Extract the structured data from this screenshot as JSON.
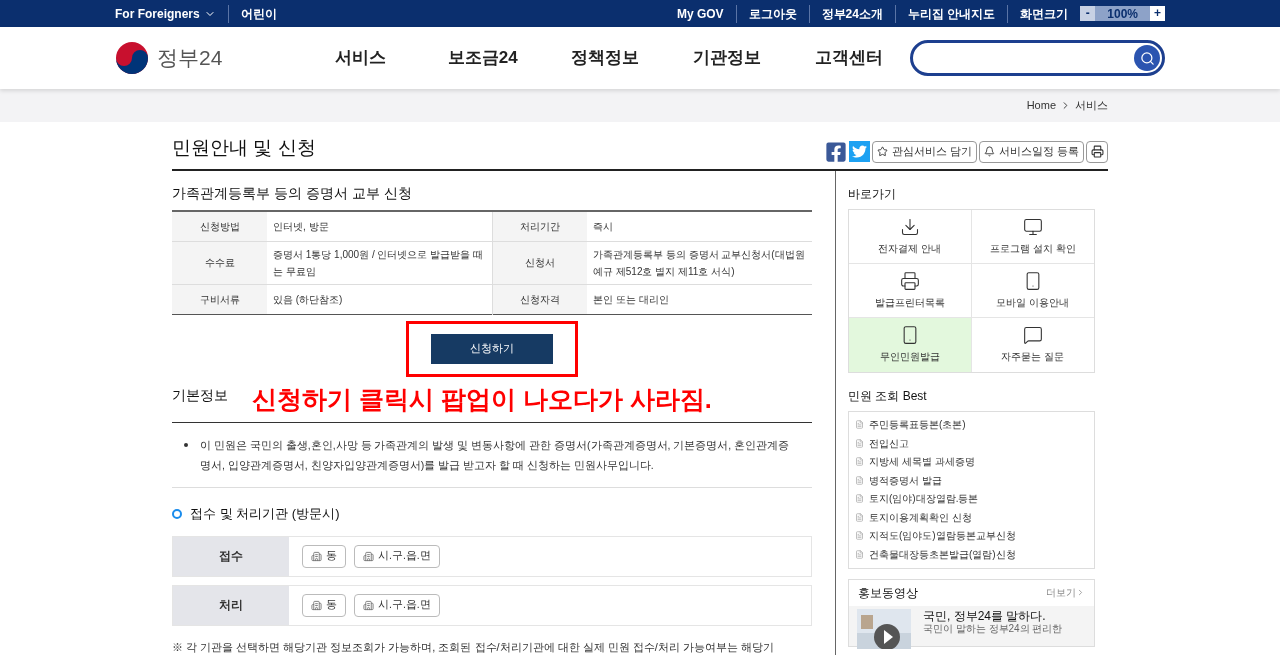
{
  "topbar": {
    "left": [
      {
        "label": "For Foreigners",
        "dropdown": true
      },
      {
        "label": "어린이",
        "dropdown": false
      }
    ],
    "right": [
      "My GOV",
      "로그아웃",
      "정부24소개",
      "누리집 안내지도"
    ],
    "zoom": {
      "label": "화면크기",
      "minus": "-",
      "value": "100%",
      "plus": "+"
    }
  },
  "header": {
    "logo": "정부24",
    "nav": [
      "서비스",
      "보조금24",
      "정책정보",
      "기관정보",
      "고객센터"
    ]
  },
  "breadcrumb": [
    "Home",
    "서비스"
  ],
  "page_title": "민원안내 및 신청",
  "actions": [
    {
      "kind": "star",
      "label": "관심서비스 담기"
    },
    {
      "kind": "bell",
      "label": "서비스일정 등록"
    }
  ],
  "service": {
    "title": "가족관계등록부 등의 증명서 교부 신청",
    "rows": [
      [
        {
          "label": "신청방법",
          "value": "인터넷, 방문"
        },
        {
          "label": "처리기간",
          "value": "즉시"
        }
      ],
      [
        {
          "label": "수수료",
          "value": "증명서 1통당 1,000원 / 인터넷으로 발급받을 때는 무료임"
        },
        {
          "label": "신청서",
          "value": "가족관계등록부 등의 증명서 교부신청서(대법원 예규 제512호 별지 제11호 서식)"
        }
      ],
      [
        {
          "label": "구비서류",
          "value": "있음 (하단참조)"
        },
        {
          "label": "신청자격",
          "value": "본인 또는 대리인"
        }
      ]
    ],
    "apply_button": "신청하기"
  },
  "annotation": "신청하기 클릭시 팝업이 나오다가 사라짐.",
  "basic_info": {
    "heading": "기본정보",
    "text": "이 민원은 국민의 출생,혼인,사망 등 가족관계의 발생 및 변동사항에 관한 증명서(가족관계증명서, 기본증명서, 혼인관계증명서, 입양관계증명서, 친양자입양관계증명서)를 발급 받고자 할 때 신청하는 민원사무입니다."
  },
  "agencies": {
    "heading": "접수 및 처리기관 (방문시)",
    "rows": [
      {
        "label": "접수",
        "items": [
          "동",
          "시.구.읍.면"
        ]
      },
      {
        "label": "처리",
        "items": [
          "동",
          "시.구.읍.면"
        ]
      }
    ]
  },
  "note": "※ 각 기관을 선택하면 해당기관 정보조회가 가능하며, 조회된 접수/처리기관에 대한 실제 민원 접수/처리 가능여부는 해당기",
  "quick": {
    "title": "바로가기",
    "items": [
      {
        "kind": "download",
        "label": "전자결제 안내",
        "highlighted": false
      },
      {
        "kind": "monitor",
        "label": "프로그램 설치 확인",
        "highlighted": false
      },
      {
        "kind": "printer",
        "label": "발급프린터목록",
        "highlighted": false
      },
      {
        "kind": "phone",
        "label": "모바일 이용안내",
        "highlighted": false
      },
      {
        "kind": "kiosk",
        "label": "무인민원발급",
        "highlighted": true
      },
      {
        "kind": "chat",
        "label": "자주묻는 질문",
        "highlighted": false
      }
    ]
  },
  "best": {
    "title": "민원 조회 Best",
    "items": [
      "주민등록표등본(초본)",
      "전입신고",
      "지방세 세목별 과세증명",
      "병적증명서 발급",
      "토지(임야)대장열람.등본",
      "토지이용계획확인 신청",
      "지적도(임야도)열람등본교부신청",
      "건축물대장등초본발급(열람)신청"
    ]
  },
  "promo": {
    "title": "홍보동영상",
    "more": "더보기",
    "video_title": "국민, 정부24를 말하다.",
    "video_desc": "국민이 말하는 정부24의 편리한"
  }
}
